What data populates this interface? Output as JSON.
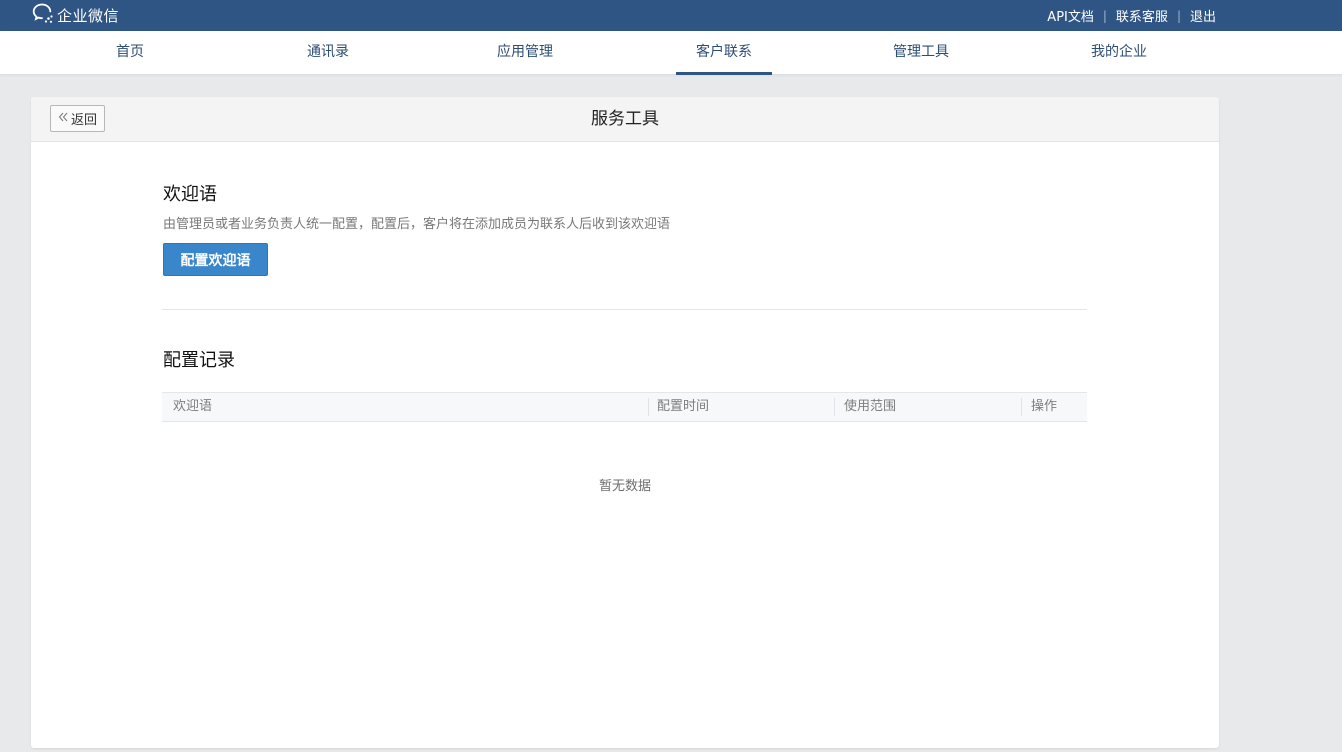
{
  "topbar": {
    "logo_text": "企业微信",
    "links": [
      "API文档",
      "联系客服",
      "退出"
    ]
  },
  "nav": {
    "items": [
      "首页",
      "通讯录",
      "应用管理",
      "客户联系",
      "管理工具",
      "我的企业"
    ],
    "active": "客户联系"
  },
  "panel": {
    "back_label": "返回",
    "title": "服务工具"
  },
  "welcome": {
    "title": "欢迎语",
    "description": "由管理员或者业务负责人统一配置，配置后，客户将在添加成员为联系人后收到该欢迎语",
    "button_label": "配置欢迎语"
  },
  "records": {
    "title": "配置记录",
    "columns": [
      "欢迎语",
      "配置时间",
      "使用范围",
      "操作"
    ],
    "empty_text": "暂无数据"
  }
}
